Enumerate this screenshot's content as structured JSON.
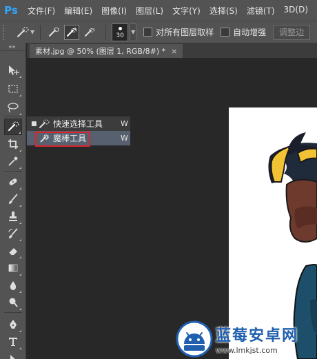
{
  "app": {
    "logo": "Ps",
    "menu": [
      "文件(F)",
      "编辑(E)",
      "图像(I)",
      "图层(L)",
      "文字(Y)",
      "选择(S)",
      "滤镜(T)",
      "3D(D)"
    ]
  },
  "options": {
    "brush_size": "30",
    "sample_all_layers": "对所有图层取样",
    "auto_enhance": "自动增强",
    "refine_edge": "调整边"
  },
  "tab": {
    "title": "素材.jpg @ 50% (图层 1, RGB/8#) *",
    "close": "×"
  },
  "flyout": {
    "items": [
      {
        "label": "快速选择工具",
        "shortcut": "W",
        "bullet": "■"
      },
      {
        "label": "魔棒工具",
        "shortcut": "W",
        "bullet": ""
      }
    ]
  },
  "toolbar": {
    "grip": "▸▸"
  },
  "watermark": {
    "title": "蓝莓安卓网",
    "url": "www.lmkjst.com"
  },
  "colors": {
    "panel": "#535353",
    "canvas_bg": "#282828",
    "highlight": "#56606e",
    "annotation_red": "#d9252c",
    "watermark_blue": "#1f5fae"
  }
}
